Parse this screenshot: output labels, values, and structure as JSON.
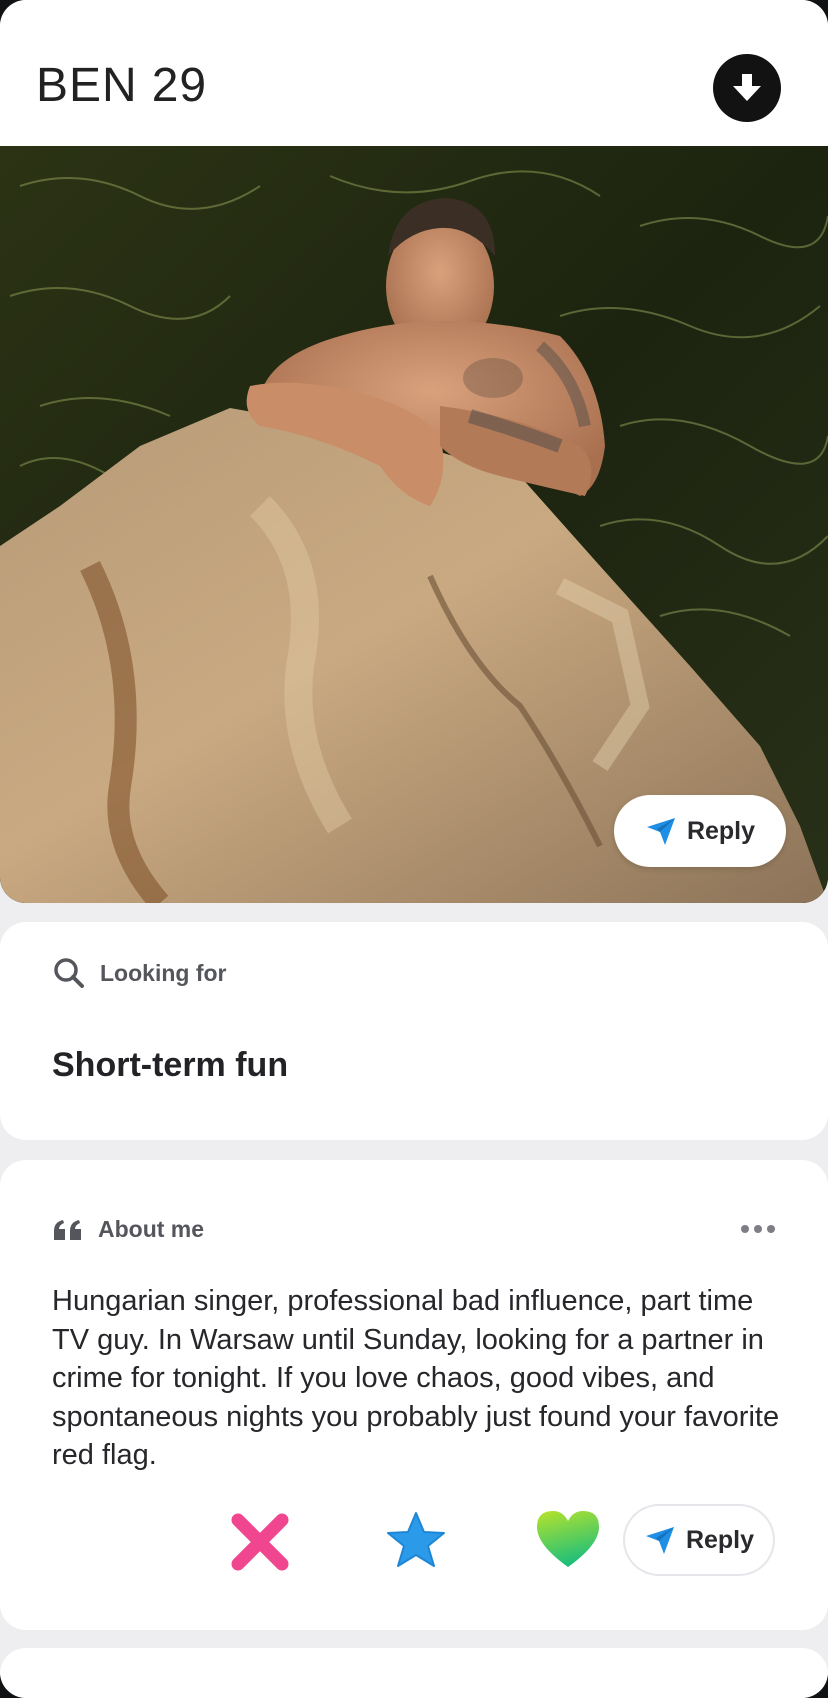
{
  "header": {
    "name": "BEN",
    "age": "29",
    "download_icon": "arrow-down-circle-icon"
  },
  "photo": {
    "reply_label": "Reply",
    "send_icon": "paper-plane-icon"
  },
  "looking_for": {
    "label": "Looking for",
    "icon": "search-icon",
    "value": "Short-term fun"
  },
  "about": {
    "label": "About me",
    "icon": "quote-icon",
    "more_icon": "more-dots-icon",
    "text": "Hungarian singer, professional bad influence, part time TV guy. In Warsaw until Sunday, looking for a partner in crime for tonight. If you love chaos, good vibes, and spontaneous nights you probably just found your favorite red flag."
  },
  "actions": {
    "nope_icon": "x-icon",
    "superlike_icon": "star-icon",
    "like_icon": "heart-icon",
    "reply_label": "Reply"
  },
  "colors": {
    "nope": "#f0468f",
    "superlike": "#2b9ae8",
    "like_start": "#b7e32b",
    "like_end": "#1fbf7a",
    "send": "#1f8fe5"
  }
}
